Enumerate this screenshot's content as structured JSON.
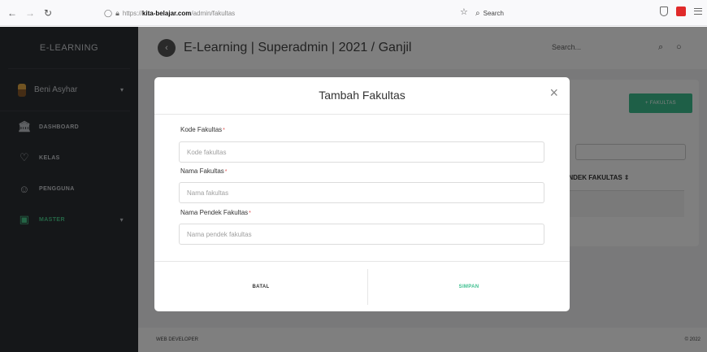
{
  "browser": {
    "url_prefix": "https://",
    "url_domain": "kita-belajar.com",
    "url_path": "/admin/fakultas",
    "search_placeholder": "Search"
  },
  "sidebar": {
    "brand": "E-LEARNING",
    "user_name": "Beni Asyhar",
    "items": [
      {
        "label": "DASHBOARD",
        "icon": "bank-icon"
      },
      {
        "label": "KELAS",
        "icon": "heart-hands-icon"
      },
      {
        "label": "PENGGUNA",
        "icon": "user-icon"
      },
      {
        "label": "MASTER",
        "icon": "monitor-icon",
        "active": true
      }
    ]
  },
  "topbar": {
    "title": "E-Learning | Superadmin | 2021 / Ganjil",
    "search_placeholder": "Search..."
  },
  "card": {
    "add_button": "+ FAKULTAS",
    "column_header": "ENDEK FAKULTAS ⇕"
  },
  "footer": {
    "left": "WEB DEVELOPER",
    "right": "© 2022"
  },
  "modal": {
    "title": "Tambah Fakultas",
    "close": "×",
    "fields": [
      {
        "label": "Kode Fakultas",
        "required": "*",
        "placeholder": "Kode fakultas",
        "value": ""
      },
      {
        "label": "Nama Fakultas",
        "required": "*",
        "placeholder": "Nama fakultas",
        "value": ""
      },
      {
        "label": "Nama Pendek Fakultas",
        "required": "*",
        "placeholder": "Nama pendek fakultas",
        "value": ""
      }
    ],
    "cancel_label": "BATAL",
    "submit_label": "SIMPAN"
  },
  "colors": {
    "accent": "#3cbf8e",
    "sidebar_bg": "#2b2e33",
    "required": "#e05050"
  }
}
